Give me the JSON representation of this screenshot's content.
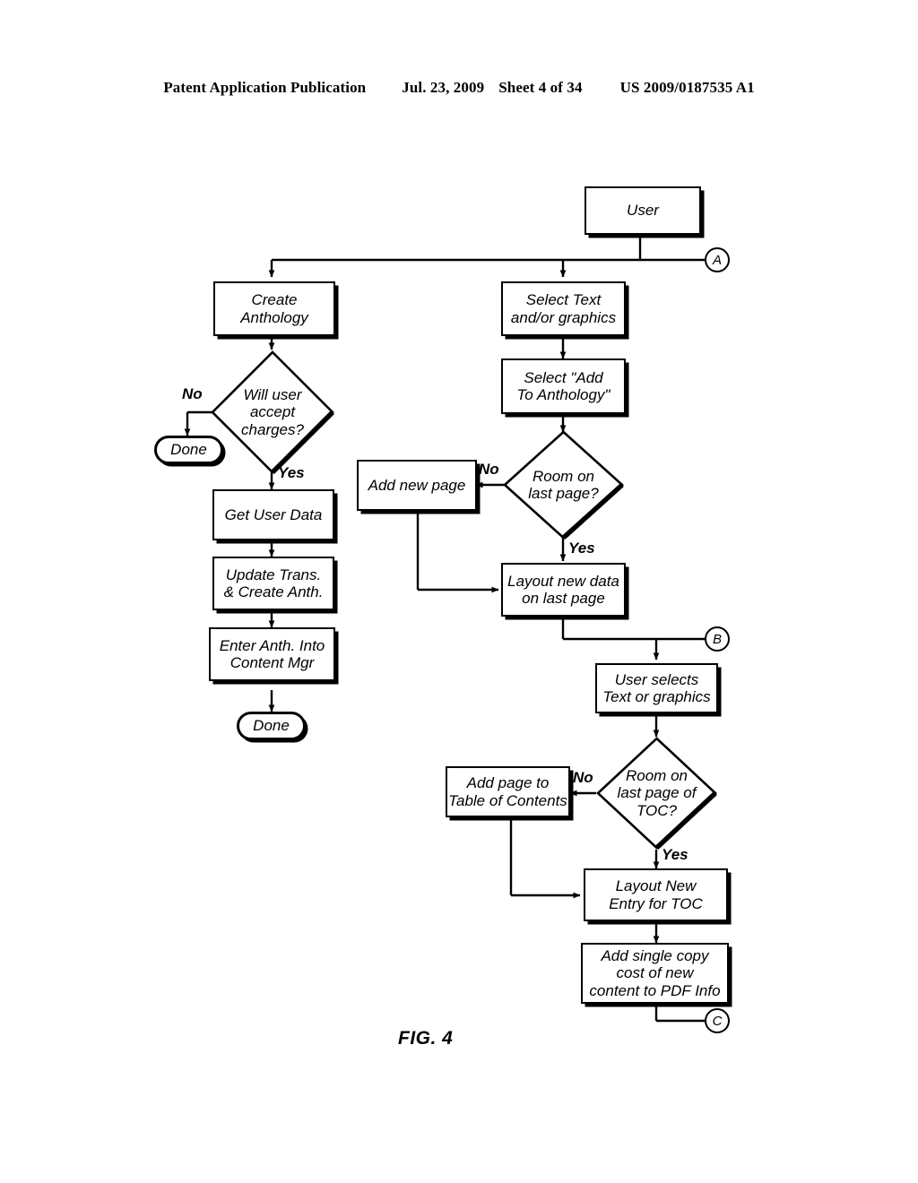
{
  "header": {
    "publication": "Patent Application Publication",
    "date": "Jul. 23, 2009",
    "sheet": "Sheet 4 of 34",
    "patent_number": "US 2009/0187535 A1"
  },
  "figure": {
    "caption": "FIG. 4"
  },
  "nodes": {
    "user": "User",
    "create_anthology": "Create\nAnthology",
    "will_user_accept": "Will user\naccept\ncharges?",
    "done_left": "Done",
    "get_user_data": "Get User Data",
    "update_trans": "Update Trans.\n& Create Anth.",
    "enter_anth": "Enter Anth. Into\nContent Mgr",
    "done_bottom": "Done",
    "select_text": "Select Text\nand/or graphics",
    "select_add": "Select \"Add\nTo Anthology\"",
    "room_last_page": "Room on\nlast page?",
    "add_new_page": "Add new page",
    "layout_new_data": "Layout new data\non last page",
    "user_selects": "User selects\nText or graphics",
    "room_toc": "Room on\nlast page of\nTOC?",
    "add_page_toc": "Add page to\nTable of Contents",
    "layout_new_entry": "Layout New\nEntry for TOC",
    "add_cost": "Add single copy\ncost of new\ncontent to PDF Info"
  },
  "edge_labels": {
    "no_charges": "No",
    "yes_charges": "Yes",
    "no_room_page": "No",
    "yes_room_page": "Yes",
    "no_room_toc": "No",
    "yes_room_toc": "Yes"
  },
  "connectors": {
    "a": "A",
    "b": "B",
    "c": "C"
  },
  "colors": {
    "ink": "#000000",
    "paper": "#ffffff"
  }
}
